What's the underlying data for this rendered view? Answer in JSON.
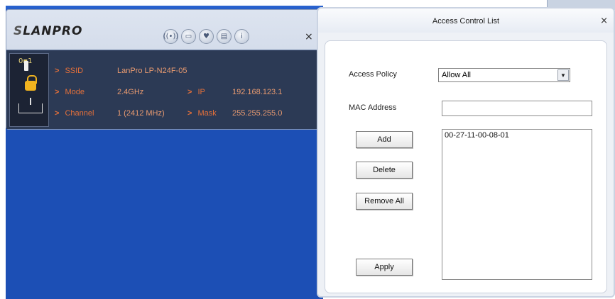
{
  "lanpro_window": {
    "logo": "LANPRO",
    "icons": [
      "wireless-icon",
      "network-icon",
      "heart-icon",
      "document-icon",
      "info-icon"
    ],
    "close": "×",
    "status": {
      "ssid_label": "SSID",
      "ssid_value": "LanPro LP-N24F-05",
      "mode_label": "Mode",
      "mode_value": "2.4GHz",
      "channel_label": "Channel",
      "channel_value": "1 (2412 MHz)",
      "ip_label": "IP",
      "ip_value": "192.168.123.1",
      "mask_label": "Mask",
      "mask_value": "255.255.255.0"
    }
  },
  "acl_dialog": {
    "title": "Access Control List",
    "close": "×",
    "access_policy_label": "Access Policy",
    "access_policy_value": "Allow All",
    "mac_address_label": "MAC Address",
    "mac_address_value": "",
    "mac_list": [
      "00-27-11-00-08-01"
    ],
    "buttons": {
      "add": "Add",
      "delete": "Delete",
      "remove_all": "Remove All",
      "apply": "Apply"
    }
  },
  "colors": {
    "desktop_blue": "#1c4fb5",
    "status_panel": "#2c3a55",
    "status_text": "#e4703a"
  }
}
